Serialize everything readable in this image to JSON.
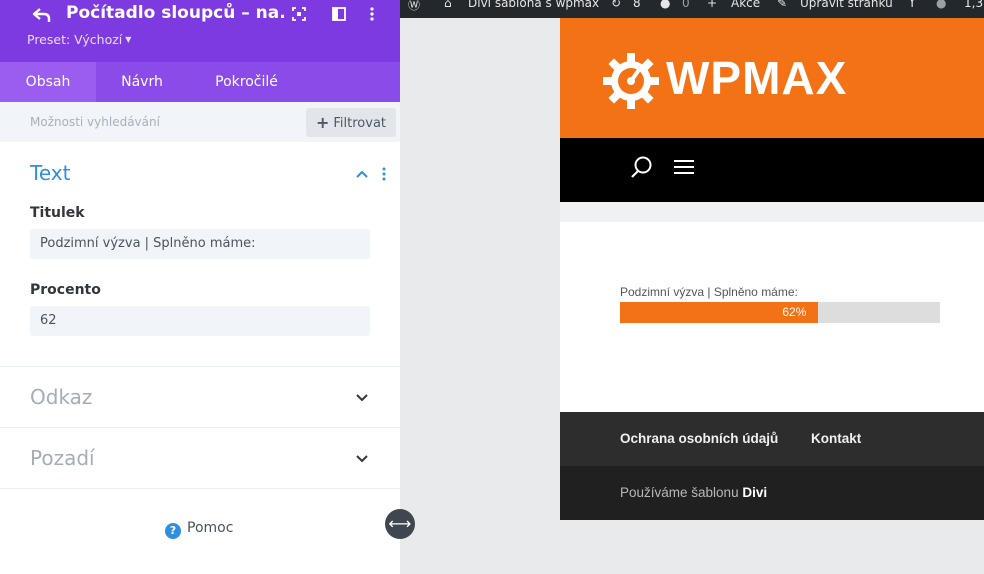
{
  "panel": {
    "title": "Počítadlo sloupců – na...",
    "preset": "Preset: Výchozí",
    "tabs": [
      {
        "label": "Obsah",
        "active": true
      },
      {
        "label": "Návrh",
        "active": false
      },
      {
        "label": "Pokročilé",
        "active": false
      }
    ],
    "search_placeholder": "Možnosti vyhledávání",
    "filter_label": "Filtrovat",
    "sections": {
      "text": {
        "title": "Text",
        "fields": {
          "titulek_label": "Titulek",
          "titulek_value": "Podzimní výzva | Splněno máme:",
          "procento_label": "Procento",
          "procento_value": "62"
        }
      },
      "odkaz": {
        "title": "Odkaz"
      },
      "pozadi": {
        "title": "Pozadí"
      }
    },
    "help_label": "Pomoc",
    "accent_color": "#7d3ae0",
    "active_title_color": "#2e8fdd"
  },
  "adminbar": {
    "site_name": "Divi šablona s wpmax",
    "updates_count": "8",
    "comments_count": "0",
    "new_label": "Akce",
    "edit_label": "Upravit stránku",
    "extra": "1,3"
  },
  "site": {
    "logo_text": "WPMAX",
    "brand_color": "#f47216",
    "bar_counter": {
      "label": "Podzimní výzva | Splněno máme:",
      "percent": 62,
      "percent_label": "62%"
    },
    "footer_menu": [
      "Ochrana osobních údajů",
      "Kontakt"
    ],
    "credits_prefix": "Používáme šablonu",
    "credits_theme": "Divi"
  }
}
